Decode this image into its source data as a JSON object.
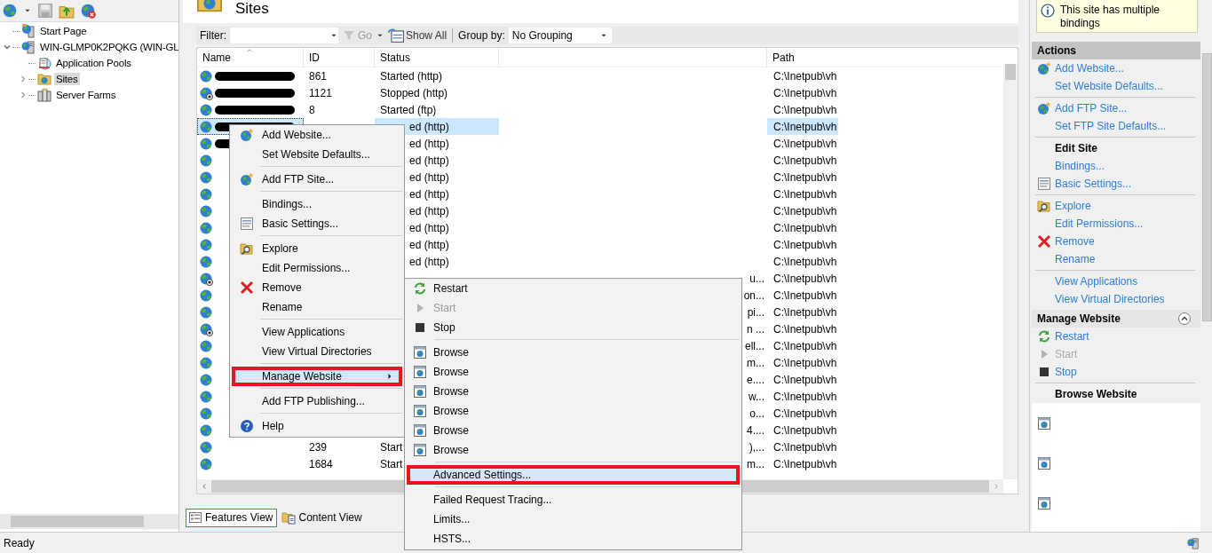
{
  "tree": [
    {
      "label": "Start Page",
      "kind": "start-page",
      "selected": false
    },
    {
      "label": "WIN-GLMP0K2PQKG (WIN-GL",
      "kind": "server",
      "selected": false,
      "expanded": true,
      "children": [
        {
          "label": "Application Pools",
          "kind": "pools",
          "selected": false
        },
        {
          "label": "Sites",
          "kind": "sites",
          "selected": true,
          "expanded": false
        },
        {
          "label": "Server Farms",
          "kind": "farms",
          "selected": false,
          "expanded": false
        }
      ]
    }
  ],
  "page_title": "Sites",
  "filter": {
    "label": "Filter:",
    "go": "Go",
    "show_all": "Show All",
    "group_by_label": "Group by:",
    "group_by": "No Grouping"
  },
  "table": {
    "columns": [
      "Name",
      "ID",
      "Status",
      "Path"
    ],
    "rows": [
      {
        "kind": "full",
        "stopped": false,
        "redacted": true,
        "selected": false,
        "id": "861",
        "status": "Started (http)",
        "path": "C:\\Inetpub\\vh"
      },
      {
        "kind": "full",
        "stopped": true,
        "redacted": true,
        "selected": false,
        "id": "1121",
        "status": "Stopped (http)",
        "path": "C:\\Inetpub\\vh"
      },
      {
        "kind": "full",
        "stopped": false,
        "redacted": true,
        "selected": false,
        "id": "8",
        "status": "Started (ftp)",
        "path": "C:\\Inetpub\\vh"
      },
      {
        "kind": "behind_menu",
        "stopped": false,
        "redacted": true,
        "selected": true,
        "status": "ed (http)",
        "path": "C:\\Inetpub\\vh"
      },
      {
        "kind": "behind_menu",
        "stopped": false,
        "redacted": true,
        "selected": false,
        "status": "ed (http)",
        "path": "C:\\Inetpub\\vh"
      },
      {
        "kind": "behind_menu",
        "stopped": false,
        "redacted": false,
        "selected": false,
        "status": "ed (http)",
        "path": "C:\\Inetpub\\vh"
      },
      {
        "kind": "behind_menu",
        "stopped": false,
        "redacted": false,
        "selected": false,
        "status": "ed (http)",
        "path": "C:\\Inetpub\\vh"
      },
      {
        "kind": "behind_menu",
        "stopped": false,
        "redacted": false,
        "selected": false,
        "status": "ed (http)",
        "path": "C:\\Inetpub\\vh"
      },
      {
        "kind": "behind_menu",
        "stopped": false,
        "redacted": false,
        "selected": false,
        "status": "ed (http)",
        "path": "C:\\Inetpub\\vh"
      },
      {
        "kind": "behind_menu",
        "stopped": false,
        "redacted": false,
        "selected": false,
        "status": "ed (http)",
        "path": "C:\\Inetpub\\vh"
      },
      {
        "kind": "behind_menu",
        "stopped": false,
        "redacted": false,
        "selected": false,
        "status": "ed (http)",
        "path": "C:\\Inetpub\\vh"
      },
      {
        "kind": "behind_menu",
        "stopped": false,
        "redacted": false,
        "selected": false,
        "status": "ed (http)",
        "path": "C:\\Inetpub\\vh"
      },
      {
        "kind": "behind_submenu",
        "stopped": true,
        "redacted": false,
        "selected": false,
        "column_4": "u...",
        "path": "C:\\Inetpub\\vh"
      },
      {
        "kind": "behind_submenu",
        "stopped": false,
        "redacted": false,
        "selected": false,
        "column_4": "on...",
        "path": "C:\\Inetpub\\vh"
      },
      {
        "kind": "behind_submenu",
        "stopped": false,
        "redacted": false,
        "selected": false,
        "column_4": "pi...",
        "path": "C:\\Inetpub\\vh"
      },
      {
        "kind": "behind_submenu",
        "stopped": true,
        "redacted": false,
        "selected": false,
        "column_4": "n ...",
        "path": "C:\\Inetpub\\vh"
      },
      {
        "kind": "behind_submenu",
        "stopped": false,
        "redacted": false,
        "selected": false,
        "column_4": "ell...",
        "path": "C:\\Inetpub\\vh"
      },
      {
        "kind": "behind_submenu",
        "stopped": false,
        "redacted": false,
        "selected": false,
        "column_4": "m...",
        "path": "C:\\Inetpub\\vh"
      },
      {
        "kind": "behind_submenu",
        "stopped": false,
        "redacted": false,
        "selected": false,
        "column_4": "e....",
        "path": "C:\\Inetpub\\vh"
      },
      {
        "kind": "behind_submenu",
        "stopped": false,
        "redacted": false,
        "selected": false,
        "column_4": "w...",
        "path": "C:\\Inetpub\\vh"
      },
      {
        "kind": "behind_submenu",
        "stopped": false,
        "redacted": false,
        "selected": false,
        "column_4": "o...",
        "path": "C:\\Inetpub\\vh"
      },
      {
        "kind": "behind_submenu",
        "stopped": false,
        "redacted": false,
        "selected": false,
        "column_4": "4....",
        "path": "C:\\Inetpub\\vh"
      },
      {
        "kind": "full",
        "stopped": false,
        "redacted": false,
        "selected": false,
        "id": "239",
        "status": "Start",
        "column_4": "),...",
        "path": "C:\\Inetpub\\vh"
      },
      {
        "kind": "full",
        "stopped": false,
        "redacted": false,
        "selected": false,
        "id": "1684",
        "status": "Start",
        "column_4": "m...",
        "path": "C:\\Inetpub\\vh"
      }
    ]
  },
  "view_tabs": [
    {
      "label": "Features View",
      "kind": "features",
      "selected": true
    },
    {
      "label": "Content View",
      "kind": "content",
      "selected": false
    }
  ],
  "context_menu": [
    {
      "kind": "globe-star",
      "label": "Add Website...",
      "selected": false
    },
    {
      "kind": "item",
      "label": "Set Website Defaults...",
      "selected": false
    },
    {
      "kind": "separator"
    },
    {
      "kind": "globe-star",
      "label": "Add FTP Site...",
      "selected": false
    },
    {
      "kind": "separator"
    },
    {
      "kind": "item",
      "label": "Bindings...",
      "selected": false
    },
    {
      "kind": "settings",
      "label": "Basic Settings...",
      "selected": false
    },
    {
      "kind": "separator"
    },
    {
      "kind": "explore",
      "label": "Explore",
      "selected": false
    },
    {
      "kind": "item",
      "label": "Edit Permissions...",
      "selected": false
    },
    {
      "kind": "remove",
      "label": "Remove",
      "selected": false
    },
    {
      "kind": "item",
      "label": "Rename",
      "selected": false
    },
    {
      "kind": "separator"
    },
    {
      "kind": "item",
      "label": "View Applications",
      "selected": false
    },
    {
      "kind": "item",
      "label": "View Virtual Directories",
      "selected": false
    },
    {
      "kind": "separator"
    },
    {
      "kind": "submenu",
      "label": "Manage Website",
      "selected": true,
      "outlined": true
    },
    {
      "kind": "separator"
    },
    {
      "kind": "item",
      "label": "Add FTP Publishing...",
      "selected": false
    },
    {
      "kind": "separator"
    },
    {
      "kind": "help",
      "label": "Help",
      "selected": false
    }
  ],
  "submenu": [
    {
      "kind": "restart",
      "label": "Restart",
      "selected": false
    },
    {
      "kind": "start",
      "label": "Start",
      "selected": false,
      "disabled": true
    },
    {
      "kind": "stop",
      "label": "Stop",
      "selected": false
    },
    {
      "kind": "separator"
    },
    {
      "kind": "browse",
      "label": "Browse",
      "selected": false
    },
    {
      "kind": "browse",
      "label": "Browse",
      "selected": false
    },
    {
      "kind": "browse",
      "label": "Browse",
      "selected": false
    },
    {
      "kind": "browse",
      "label": "Browse",
      "selected": false
    },
    {
      "kind": "browse",
      "label": "Browse",
      "selected": false
    },
    {
      "kind": "browse",
      "label": "Browse",
      "selected": false
    },
    {
      "kind": "separator"
    },
    {
      "kind": "item",
      "label": "Advanced Settings...",
      "selected": true,
      "outlined": true
    },
    {
      "kind": "separator"
    },
    {
      "kind": "item",
      "label": "Failed Request Tracing...",
      "selected": false
    },
    {
      "kind": "item",
      "label": "Limits...",
      "selected": false
    },
    {
      "kind": "item",
      "label": "HSTS...",
      "selected": false
    }
  ],
  "info": {
    "text": "This site has multiple bindings"
  },
  "actions": {
    "title": "Actions",
    "items": [
      {
        "kind": "globe-star",
        "label": "Add Website..."
      },
      {
        "kind": "link",
        "label": "Set Website Defaults..."
      },
      {
        "kind": "separator"
      },
      {
        "kind": "globe-star",
        "label": "Add FTP Site..."
      },
      {
        "kind": "link",
        "label": "Set FTP Site Defaults..."
      },
      {
        "kind": "separator"
      },
      {
        "kind": "header",
        "label": "Edit Site"
      },
      {
        "kind": "link",
        "label": "Bindings..."
      },
      {
        "kind": "settings",
        "label": "Basic Settings..."
      },
      {
        "kind": "separator"
      },
      {
        "kind": "explore",
        "label": "Explore"
      },
      {
        "kind": "link",
        "label": "Edit Permissions..."
      },
      {
        "kind": "remove",
        "label": "Remove"
      },
      {
        "kind": "link",
        "label": "Rename"
      },
      {
        "kind": "separator"
      },
      {
        "kind": "link",
        "label": "View Applications"
      },
      {
        "kind": "link",
        "label": "View Virtual Directories"
      },
      {
        "kind": "section",
        "label": "Manage Website",
        "expanded": true
      },
      {
        "kind": "restart",
        "label": "Restart",
        "disabled": false
      },
      {
        "kind": "start",
        "label": "Start",
        "disabled": true
      },
      {
        "kind": "stop",
        "label": "Stop",
        "disabled": false
      },
      {
        "kind": "separator"
      },
      {
        "kind": "header",
        "label": "Browse Website"
      },
      {
        "kind": "browse"
      },
      {
        "kind": "browse"
      },
      {
        "kind": "browse"
      }
    ]
  },
  "status_bar": {
    "text": "Ready"
  }
}
